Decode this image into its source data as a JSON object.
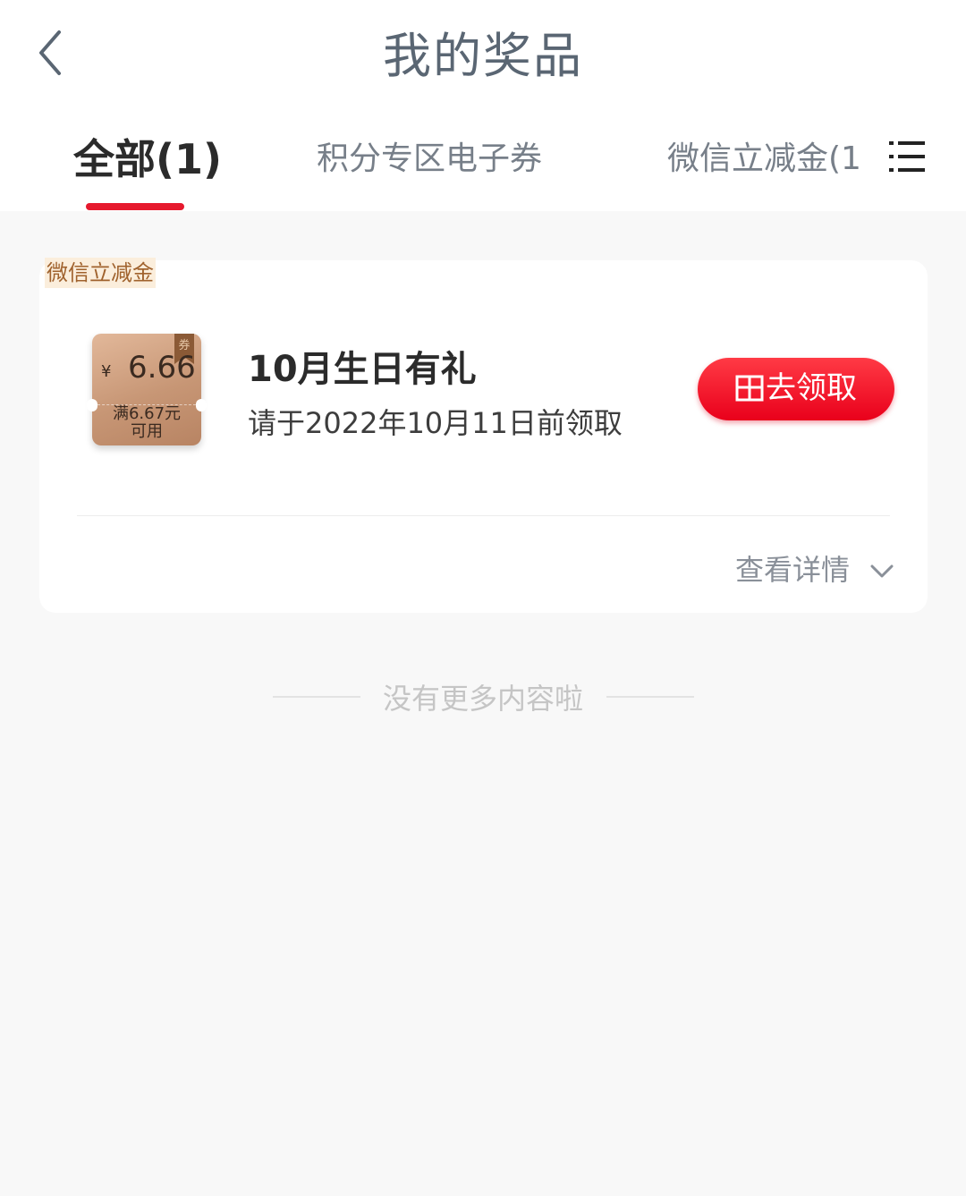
{
  "header": {
    "title": "我的奖品",
    "back_icon": "chevron-left-icon"
  },
  "tabs": [
    {
      "label": "全部(1)",
      "active": true
    },
    {
      "label": "积分专区电子券",
      "active": false
    },
    {
      "label": "微信立减金(1",
      "active": false
    }
  ],
  "menu_icon": "list-menu-icon",
  "colors": {
    "accent": "#e6192e",
    "button_start": "#ff3a45",
    "button_end": "#e9001b",
    "tag_bg": "#fbeedc",
    "tag_text": "#a0622d",
    "page_bg": "#f8f8f8"
  },
  "prize": {
    "category_tag": "微信立减金",
    "coupon": {
      "ribbon_text": "券",
      "currency": "¥",
      "amount": "6.66",
      "condition_line1": "满6.67元",
      "condition_line2": "可用"
    },
    "title": "10月生日有礼",
    "deadline": "请于2022年10月11日前领取",
    "claim_button": "去领取",
    "claim_button_icon": "wallet-icon",
    "detail_link": "查看详情",
    "detail_icon": "chevron-down-icon"
  },
  "footer": {
    "end_text": "没有更多内容啦"
  }
}
